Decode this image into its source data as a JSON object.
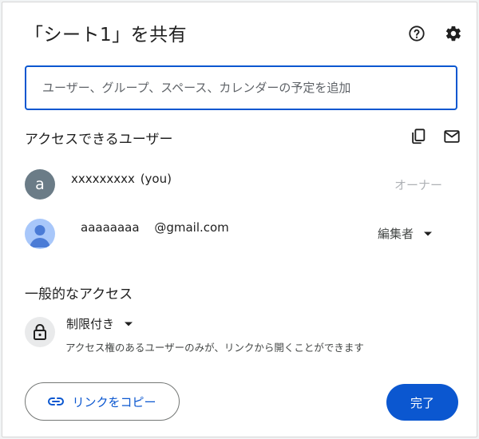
{
  "dialog": {
    "title": "「シート1」を共有",
    "icons": {
      "help": "help-icon",
      "settings": "gear-icon"
    }
  },
  "search": {
    "placeholder": "ユーザー、グループ、スペース、カレンダーの予定を追加",
    "value": ""
  },
  "people_section": {
    "title": "アクセスできるユーザー",
    "icons": {
      "copy_emails": "copy-icon",
      "email": "email-icon"
    },
    "users": [
      {
        "avatar_letter": "a",
        "avatar_color": "#6b7c87",
        "name": "xxxxxxxxx",
        "you_label": "(you)",
        "role": "オーナー"
      },
      {
        "avatar_color": "#a8c7fa",
        "name_prefix": "aaaaaaaa",
        "email_domain": "@gmail.com",
        "role": "編集者"
      }
    ]
  },
  "general_access": {
    "title": "一般的なアクセス",
    "setting": "制限付き",
    "description": "アクセス権のあるユーザーのみが、リンクから開くことができます"
  },
  "footer": {
    "copy_link_label": "リンクをコピー",
    "done_label": "完了"
  },
  "colors": {
    "accent": "#0b57d0",
    "muted_text": "#aeb1b5"
  }
}
